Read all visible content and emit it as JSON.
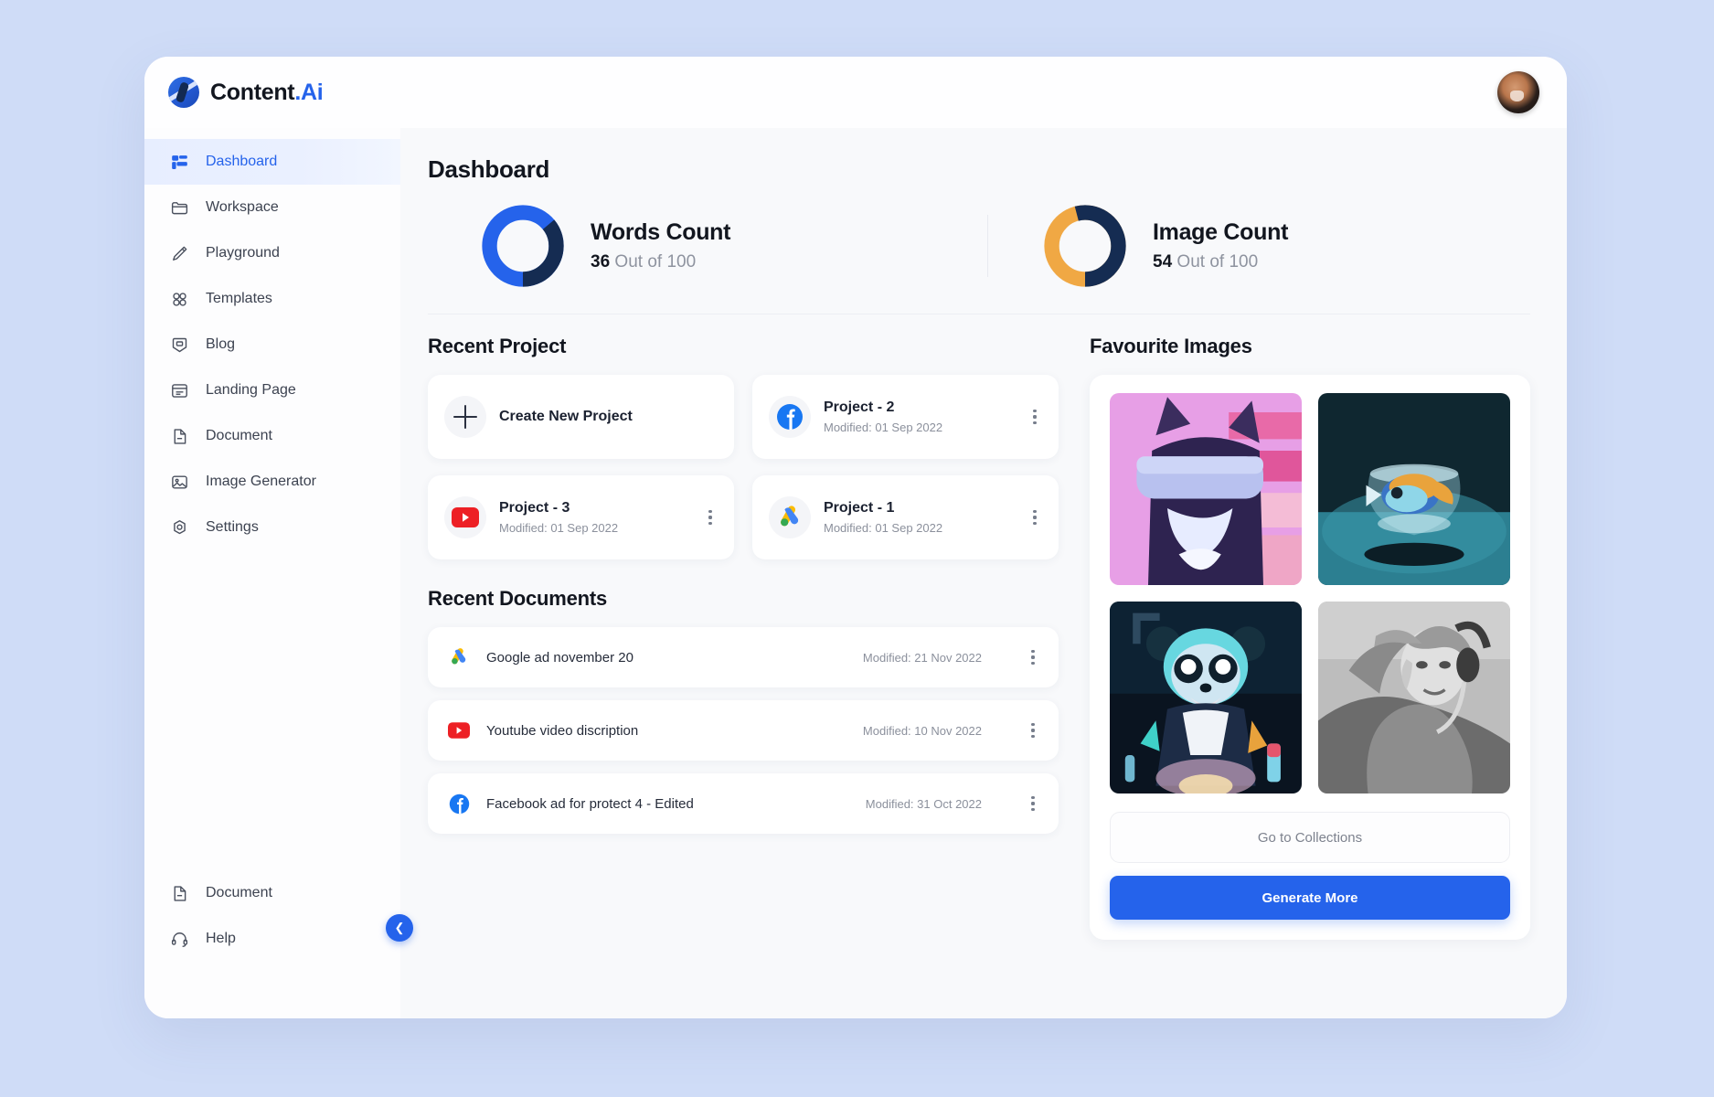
{
  "brand": {
    "name": "Content",
    "accent": ".Ai",
    "logo_icon": "content-ai-logo-icon"
  },
  "header": {
    "avatar_label": "user-avatar"
  },
  "sidebar": {
    "items": [
      {
        "label": "Dashboard",
        "icon": "grid-icon",
        "active": true
      },
      {
        "label": "Workspace",
        "icon": "folder-icon",
        "active": false
      },
      {
        "label": "Playground",
        "icon": "pencil-icon",
        "active": false
      },
      {
        "label": "Templates",
        "icon": "grid-dots-icon",
        "active": false
      },
      {
        "label": "Blog",
        "icon": "blog-icon",
        "active": false
      },
      {
        "label": "Landing Page",
        "icon": "landing-page-icon",
        "active": false
      },
      {
        "label": "Document",
        "icon": "document-icon",
        "active": false
      },
      {
        "label": "Image Generator",
        "icon": "image-icon",
        "active": false
      },
      {
        "label": "Settings",
        "icon": "gear-icon",
        "active": false
      }
    ],
    "bottom_items": [
      {
        "label": "Document",
        "icon": "document-icon"
      },
      {
        "label": "Help",
        "icon": "headset-icon"
      }
    ],
    "collapse_icon": "chevron-left-icon"
  },
  "main": {
    "page_title": "Dashboard",
    "stats": [
      {
        "label": "Words Count",
        "value": 36,
        "total": 100,
        "value_text": "36",
        "sub_text": " Out of 100",
        "fill_color": "#2563eb",
        "track_color": "#152c52"
      },
      {
        "label": "Image Count",
        "value": 54,
        "total": 100,
        "value_text": "54",
        "sub_text": " Out of 100",
        "fill_color": "#f0a844",
        "track_color": "#152c52"
      }
    ],
    "recent_project": {
      "title": "Recent Project",
      "create_label": "Create New Project",
      "create_icon": "plus-icon",
      "cards": [
        {
          "name": "Project - 2",
          "meta": "Modified: 01 Sep 2022",
          "icon": "facebook-icon",
          "menu_icon": "kebab-menu-icon"
        },
        {
          "name": "Project - 3",
          "meta": "Modified: 01 Sep 2022",
          "icon": "youtube-icon",
          "menu_icon": "kebab-menu-icon"
        },
        {
          "name": "Project - 1",
          "meta": "Modified: 01 Sep 2022",
          "icon": "google-ads-icon",
          "menu_icon": "kebab-menu-icon"
        }
      ]
    },
    "recent_documents": {
      "title": "Recent Documents",
      "rows": [
        {
          "name": "Google ad november 20",
          "meta": "Modified: 21 Nov 2022",
          "icon": "google-ads-icon",
          "menu_icon": "kebab-menu-icon"
        },
        {
          "name": "Youtube video discription",
          "meta": "Modified: 10 Nov 2022",
          "icon": "youtube-icon",
          "menu_icon": "kebab-menu-icon"
        },
        {
          "name": "Facebook ad for protect 4 - Edited",
          "meta": "Modified: 31 Oct 2022",
          "icon": "facebook-icon",
          "menu_icon": "kebab-menu-icon"
        }
      ]
    },
    "favourite_images": {
      "title": "Favourite Images",
      "thumbnails": [
        {
          "alt": "cat wearing vr headset on pink background"
        },
        {
          "alt": "clownfish in a glass fishbowl on teal background"
        },
        {
          "alt": "neon panda scientist mixing potions"
        },
        {
          "alt": "greek marble statue wearing headphones"
        }
      ],
      "collections_label": "Go to Collections",
      "generate_label": "Generate More"
    }
  },
  "colors": {
    "accent": "#2563eb",
    "navy": "#152c52",
    "orange": "#f0a844",
    "page_bg": "#cfdcf7",
    "app_bg": "#f8f9fb"
  }
}
